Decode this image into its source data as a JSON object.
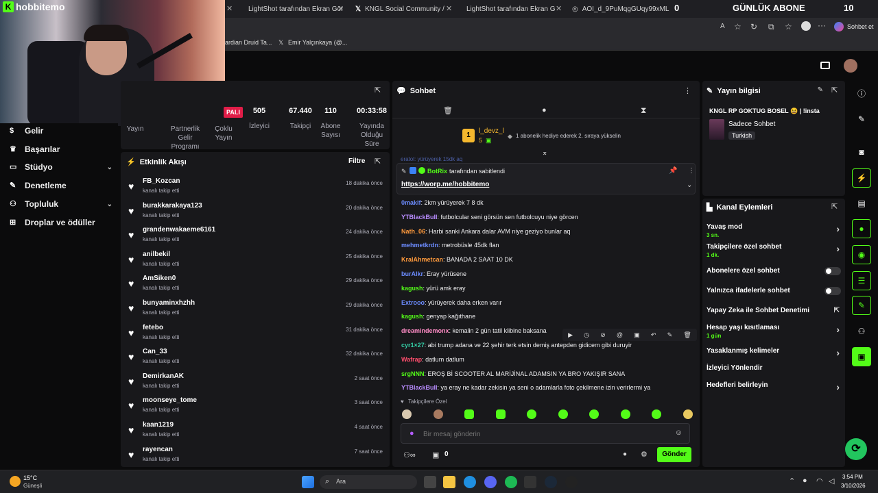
{
  "browser": {
    "tabs": [
      {
        "title": "LightShot tarafından Ekran Görün",
        "color": "#a86cf0"
      },
      {
        "title": "KNGL Social Community / X",
        "color": "#ffffff"
      },
      {
        "title": "LightShot tarafından Ekran Görün",
        "color": "#a86cf0"
      },
      {
        "title": "AOI_d_9PuMqgGUqy99xMLEgJF...",
        "color": "#cccccc"
      }
    ],
    "tab_count_badge": "0",
    "overlay_label": "GÜNLÜK ABONE",
    "overlay_count": "10",
    "chat_with_label": "Sohbet et",
    "bookmarks": [
      "ardian Druid Ta...",
      "Emir Yalçınkaya (@..."
    ]
  },
  "stream": {
    "channel_logo": "hobbitemo",
    "live_badge": "PALI",
    "stats": [
      {
        "value": "505",
        "label": "İzleyici"
      },
      {
        "value": "67.440",
        "label": "Takipçi"
      },
      {
        "value": "110",
        "label": "Abone Sayısı"
      },
      {
        "value": "00:33:58",
        "label": "Yayında Olduğu Süre"
      }
    ],
    "left_labels": [
      "Yayın",
      "Partnerlik Gelir Programı",
      "Çoklu Yayın"
    ]
  },
  "sidebar": {
    "items": [
      {
        "label": "Gelir",
        "icon": "revenue-icon",
        "chevron": false
      },
      {
        "label": "Başarılar",
        "icon": "trophy-icon",
        "chevron": false
      },
      {
        "label": "Stüdyo",
        "icon": "studio-icon",
        "chevron": true
      },
      {
        "label": "Denetleme",
        "icon": "wrench-icon",
        "chevron": false
      },
      {
        "label": "Topluluk",
        "icon": "community-icon",
        "chevron": true
      },
      {
        "label": "Droplar ve ödüller",
        "icon": "drops-icon",
        "chevron": false
      }
    ]
  },
  "activity": {
    "title": "Etkinlik Akışı",
    "filter_label": "Filtre",
    "items": [
      {
        "user": "FB_Kozcan",
        "action": "kanalı takip etti",
        "time": "18 dakika önce"
      },
      {
        "user": "burakkarakaya123",
        "action": "kanalı takip etti",
        "time": "20 dakika önce"
      },
      {
        "user": "grandenwakaeme6161",
        "action": "kanalı takip etti",
        "time": "24 dakika önce"
      },
      {
        "user": "anilbekil",
        "action": "kanalı takip etti",
        "time": "25 dakika önce"
      },
      {
        "user": "AmSiken0",
        "action": "kanalı takip etti",
        "time": "29 dakika önce"
      },
      {
        "user": "bunyaminxhzhh",
        "action": "kanalı takip etti",
        "time": "29 dakika önce"
      },
      {
        "user": "fetebo",
        "action": "kanalı takip etti",
        "time": "31 dakika önce"
      },
      {
        "user": "Can_33",
        "action": "kanalı takip etti",
        "time": "32 dakika önce"
      },
      {
        "user": "DemirkanAK",
        "action": "kanalı takip etti",
        "time": "2 saat önce"
      },
      {
        "user": "moonseye_tome",
        "action": "kanalı takip etti",
        "time": "3 saat önce"
      },
      {
        "user": "kaan1219",
        "action": "kanalı takip etti",
        "time": "4 saat önce"
      },
      {
        "user": "rayencan",
        "action": "kanalı takip etti",
        "time": "7 saat önce"
      }
    ]
  },
  "chat": {
    "title": "Sohbet",
    "leader": {
      "rank": "1",
      "name": "l_devz_l",
      "count": "5",
      "message": "1 abonelik hediye ederek 2. sıraya yükselin"
    },
    "pinned": {
      "by": "BotRix",
      "label": "tarafından sabitlendi",
      "link": "https://worp.me/hobbitemo"
    },
    "partial_line": "eratol: yürüyerek 15dk aq",
    "messages": [
      {
        "user": "0makif",
        "color": "#6c8cff",
        "text": ": 2km yürüyerek 7 8 dk"
      },
      {
        "user": "YTBlackBull",
        "color": "#b98cff",
        "text": ": futbolcular seni görsün sen futbolcuyu niye görcen"
      },
      {
        "user": "Nath_06",
        "color": "#ff9a3c",
        "text": ": Harbi sanki Ankara dalar AVM niye geziyo bunlar aq"
      },
      {
        "user": "mehmetkrdn",
        "color": "#6c8cff",
        "text": ": metrobüsle 45dk flan"
      },
      {
        "user": "KralAhmetcan",
        "color": "#ff9a3c",
        "text": ": BANADA 2 SAAT 10 DK"
      },
      {
        "user": "burAlkr",
        "color": "#6c8cff",
        "text": ": Eray yürüsene"
      },
      {
        "user": "kagush",
        "color": "#53fc18",
        "text": ": yürü amk eray"
      },
      {
        "user": "Extrooo",
        "color": "#6c8cff",
        "text": ": yürüyerek daha erken varır"
      },
      {
        "user": "kagush",
        "color": "#53fc18",
        "text": ": genyap kağıthane"
      },
      {
        "user": "dreamindemonx",
        "color": "#ff8cc6",
        "text": ": kemalin 2 gün tatil klibine baksana"
      },
      {
        "user": "cyr1×27",
        "color": "#35d0a8",
        "text": ": abi trump adana ve 22 şehir terk etsin demiş antepden gidicem gibi duruyir"
      },
      {
        "user": "Wafrap",
        "color": "#ff4d6d",
        "text": ": datlum datlum"
      },
      {
        "user": "srgNNN",
        "color": "#53fc18",
        "text": ": EROŞ Bİ SCOOTER AL MARİJİNAL ADAMSIN YA BRO YAKIŞIR SANA"
      },
      {
        "user": "YTBlackBull",
        "color": "#b98cff",
        "text": ": ya eray ne kadar zekisin ya seni o adamlarla foto çekilmene izin verirlermi ya"
      }
    ],
    "followers_only_label": "Takipçilere Özel",
    "input_placeholder": "Bir mesaj gönderin",
    "points": "0",
    "send_label": "Gönder"
  },
  "stream_info": {
    "title": "Yayın bilgisi",
    "stream_title": "KNGL RP GOKTUG BOSEL 😆 | !insta",
    "category": "Sadece Sohbet",
    "language": "Turkish"
  },
  "channel_actions": {
    "title": "Kanal Eylemleri",
    "rows": [
      {
        "label": "Yavaş mod",
        "sub": "3 sn.",
        "kind": "arrow"
      },
      {
        "label": "Takipçilere özel sohbet",
        "sub": "1 dk.",
        "kind": "arrow"
      },
      {
        "label": "Abonelere özel sohbet",
        "sub": "",
        "kind": "toggle"
      },
      {
        "label": "Yalnızca ifadelerle sohbet",
        "sub": "",
        "kind": "toggle"
      },
      {
        "label": "Yapay Zeka ile Sohbet Denetimi",
        "sub": "",
        "kind": "external"
      },
      {
        "label": "Hesap yaşı kısıtlaması",
        "sub": "1 gün",
        "kind": "arrow"
      },
      {
        "label": "Yasaklanmış kelimeler",
        "sub": "",
        "kind": "arrow"
      },
      {
        "label": "İzleyici Yönlendir",
        "sub": "",
        "kind": "none"
      },
      {
        "label": "Hedefleri belirleyin",
        "sub": "",
        "kind": "arrow"
      }
    ]
  },
  "taskbar": {
    "weather_temp": "15°C",
    "weather_desc": "Güneşli",
    "search_placeholder": "Ara",
    "time": "3:54 PM",
    "date": "3/10/2026"
  },
  "colors": {
    "accent": "#53fc18",
    "panel": "#18181b",
    "bg": "#0b0b0c"
  }
}
